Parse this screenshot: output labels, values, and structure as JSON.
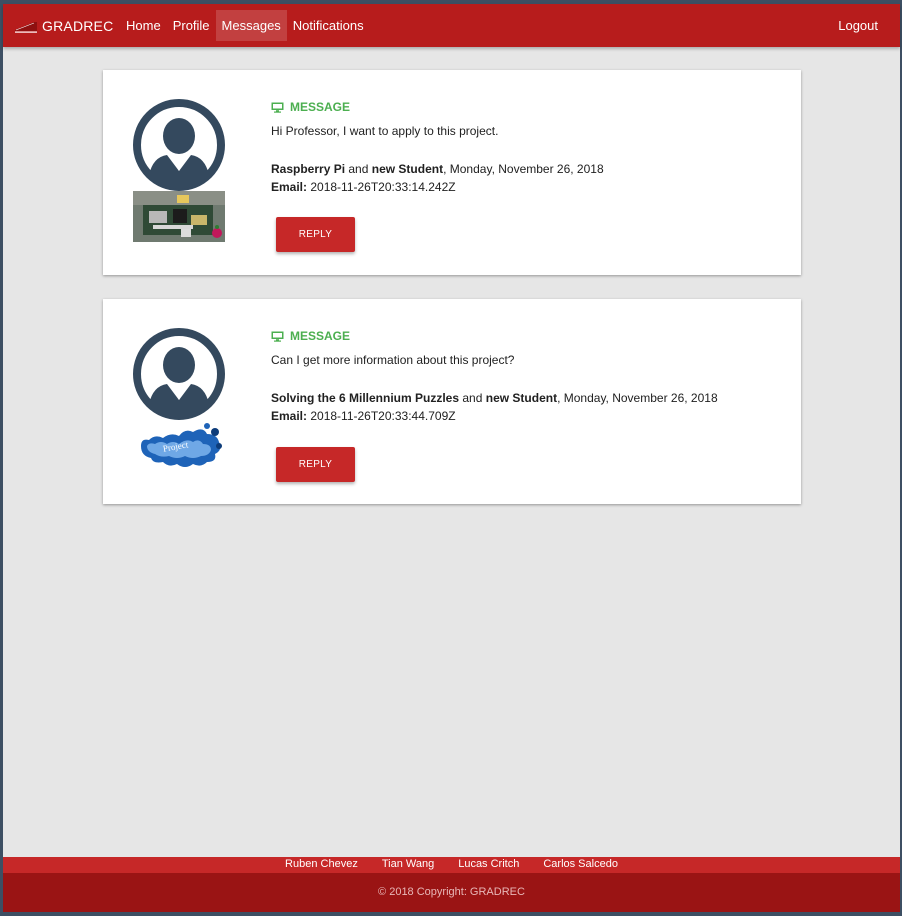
{
  "navbar": {
    "brand": "GRADREC",
    "links": [
      "Home",
      "Profile",
      "Messages",
      "Notifications"
    ],
    "active": "Messages",
    "logout": "Logout"
  },
  "messages": [
    {
      "heading": "MESSAGE",
      "text": "Hi Professor, I want to apply to this project.",
      "project": "Raspberry Pi",
      "connector": " and ",
      "sender": "new Student",
      "date": ", Monday, November 26, 2018",
      "email_label": "Email:",
      "email_value": " 2018-11-26T20:33:14.242Z",
      "reply_label": "REPLY"
    },
    {
      "heading": "MESSAGE",
      "text": "Can I get more information about this project?",
      "project": "Solving the 6 Millennium Puzzles",
      "connector": " and ",
      "sender": "new Student",
      "date": ", Monday, November 26, 2018",
      "email_label": "Email:",
      "email_value": " 2018-11-26T20:33:44.709Z",
      "reply_label": "REPLY"
    }
  ],
  "footer": {
    "links": [
      "Ruben Chevez",
      "Tian Wang",
      "Lucas Critch",
      "Carlos Salcedo"
    ],
    "copyright": "© 2018 Copyright: GRADREC"
  },
  "colors": {
    "primary": "#b71c1c",
    "button": "#c62828",
    "accent_green": "#4caf50",
    "background": "#e6e6e6"
  },
  "icons": {
    "header_icon": "desktop-icon",
    "avatar": "user-avatar-icon"
  }
}
